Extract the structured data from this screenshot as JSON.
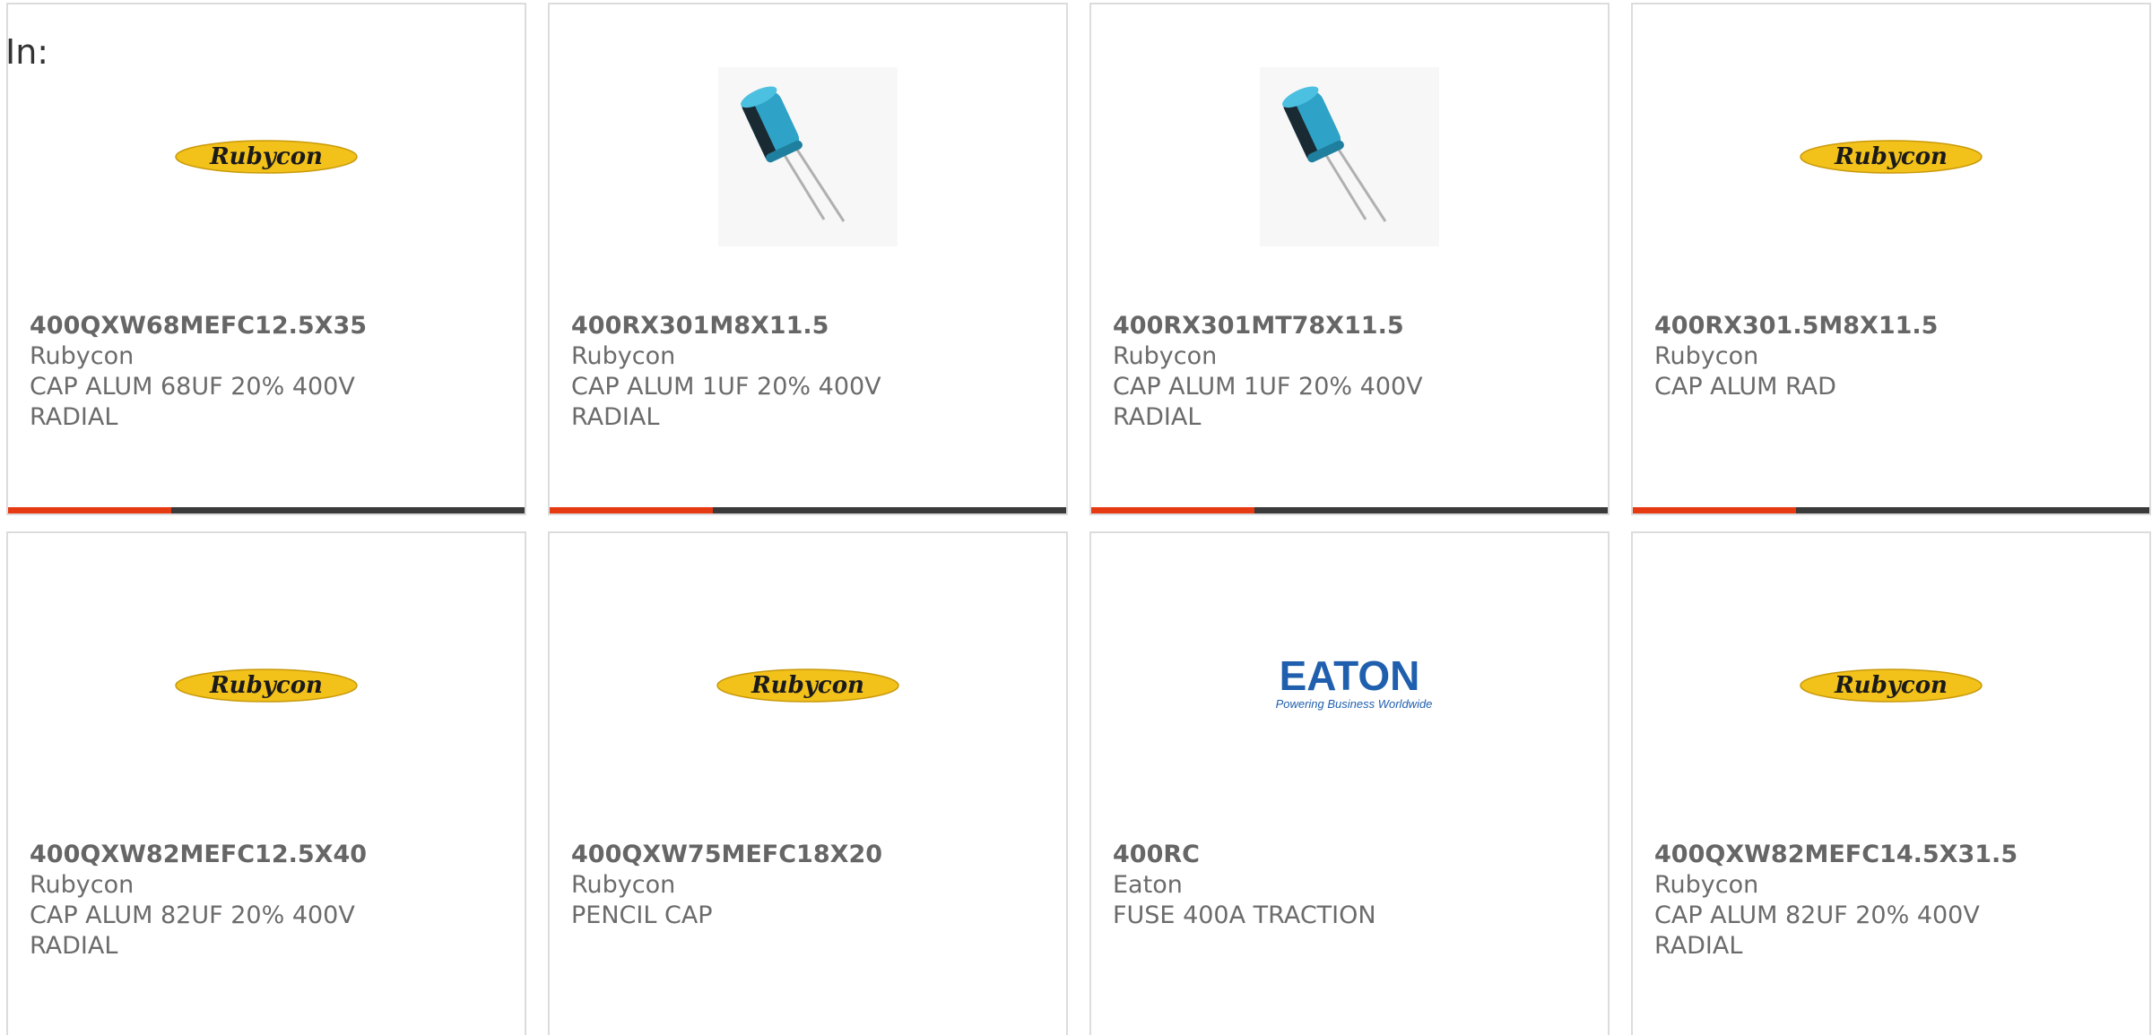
{
  "header": {
    "label": "In:"
  },
  "colors": {
    "accent": "#e63a12",
    "bar": "#3a3a3a",
    "rubycon_yellow": "#f2c11a",
    "eaton_blue": "#1f5fae"
  },
  "cards": [
    {
      "part": "400QXW68MEFC12.5X35",
      "brand": "Rubycon",
      "desc1": "CAP ALUM 68UF 20% 400V",
      "desc2": "RADIAL",
      "image": "rubycon-logo",
      "logo_text": "Rubycon"
    },
    {
      "part": "400RX301M8X11.5",
      "brand": "Rubycon",
      "desc1": "CAP ALUM 1UF 20% 400V",
      "desc2": "RADIAL",
      "image": "capacitor-photo"
    },
    {
      "part": "400RX301MT78X11.5",
      "brand": "Rubycon",
      "desc1": "CAP ALUM 1UF 20% 400V",
      "desc2": "RADIAL",
      "image": "capacitor-photo"
    },
    {
      "part": "400RX301.5M8X11.5",
      "brand": "Rubycon",
      "desc1": "CAP ALUM RAD",
      "desc2": "",
      "image": "rubycon-logo",
      "logo_text": "Rubycon"
    },
    {
      "part": "400QXW82MEFC12.5X40",
      "brand": "Rubycon",
      "desc1": "CAP ALUM 82UF 20% 400V",
      "desc2": "RADIAL",
      "image": "rubycon-logo",
      "logo_text": "Rubycon"
    },
    {
      "part": "400QXW75MEFC18X20",
      "brand": "Rubycon",
      "desc1": "PENCIL CAP",
      "desc2": "",
      "image": "rubycon-logo",
      "logo_text": "Rubycon"
    },
    {
      "part": "400RC",
      "brand": "Eaton",
      "desc1": "FUSE 400A TRACTION",
      "desc2": "",
      "image": "eaton-logo",
      "logo_text": "EATON",
      "logo_tagline": "Powering Business Worldwide"
    },
    {
      "part": "400QXW82MEFC14.5X31.5",
      "brand": "Rubycon",
      "desc1": "CAP ALUM 82UF 20% 400V",
      "desc2": "RADIAL",
      "image": "rubycon-logo",
      "logo_text": "Rubycon"
    }
  ]
}
